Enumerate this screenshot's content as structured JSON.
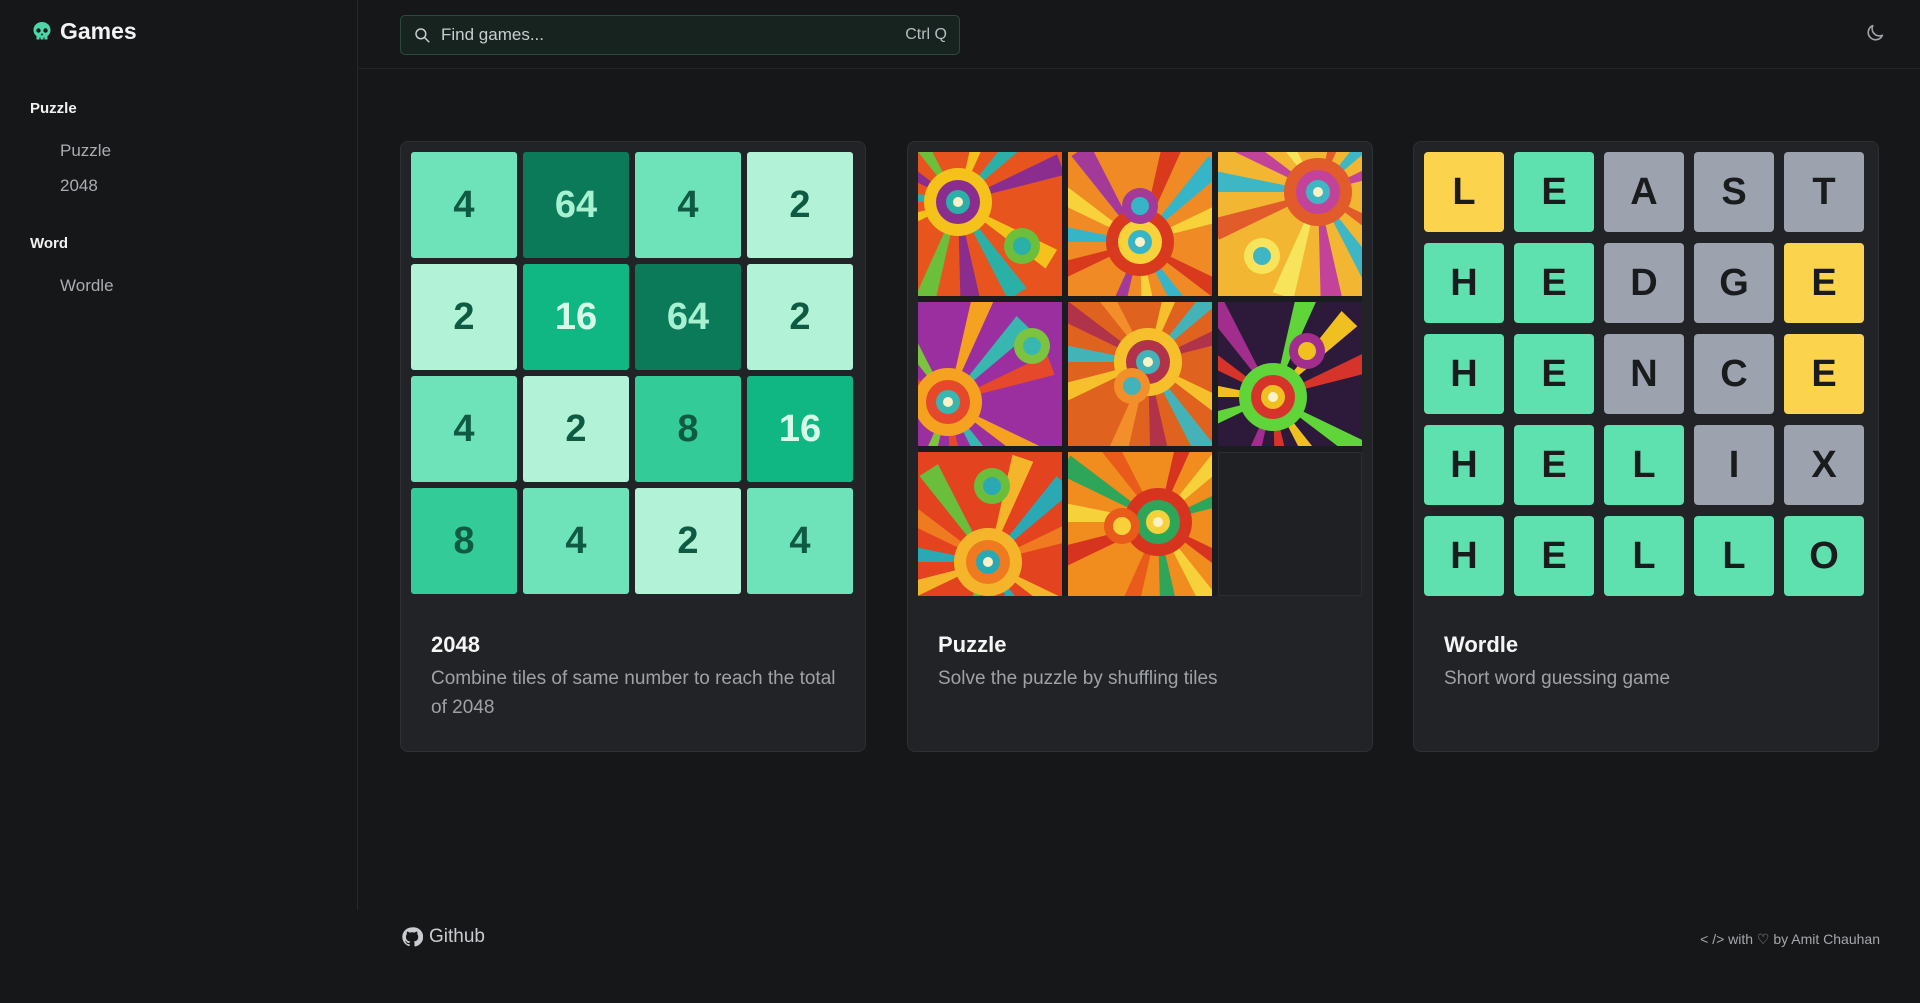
{
  "sidebar": {
    "brand": "Games",
    "groups": [
      {
        "title": "Puzzle",
        "items": [
          {
            "label": "Puzzle"
          },
          {
            "label": "2048"
          }
        ]
      },
      {
        "title": "Word",
        "items": [
          {
            "label": "Wordle"
          }
        ]
      }
    ]
  },
  "search": {
    "placeholder": "Find games...",
    "shortcut": "Ctrl Q"
  },
  "cards": [
    {
      "title": "2048",
      "description": "Combine tiles of same number to reach the total of 2048",
      "tiles": [
        "4",
        "64",
        "4",
        "2",
        "2",
        "16",
        "64",
        "2",
        "4",
        "2",
        "8",
        "16",
        "8",
        "4",
        "2",
        "4"
      ]
    },
    {
      "title": "Puzzle",
      "description": "Solve the puzzle by shuffling tiles"
    },
    {
      "title": "Wordle",
      "description": "Short word guessing game",
      "rows": [
        "LEAST",
        "HEDGE",
        "HENCE",
        "HELIX",
        "HELLO"
      ]
    }
  ],
  "footer": {
    "github": "Github",
    "credit": "< /> with ♡ by Amit Chauhan"
  },
  "colors": {
    "accent": "#5ce0b0",
    "tile_2": "#b2f2d6",
    "tile_4": "#6ee3b9",
    "tile_8": "#33cc98",
    "tile_16": "#10b783",
    "tile_64": "#0a7a58",
    "wordle_green": "#5fe0af",
    "wordle_gray": "#9ca3af",
    "wordle_yellow": "#fcd34d"
  }
}
